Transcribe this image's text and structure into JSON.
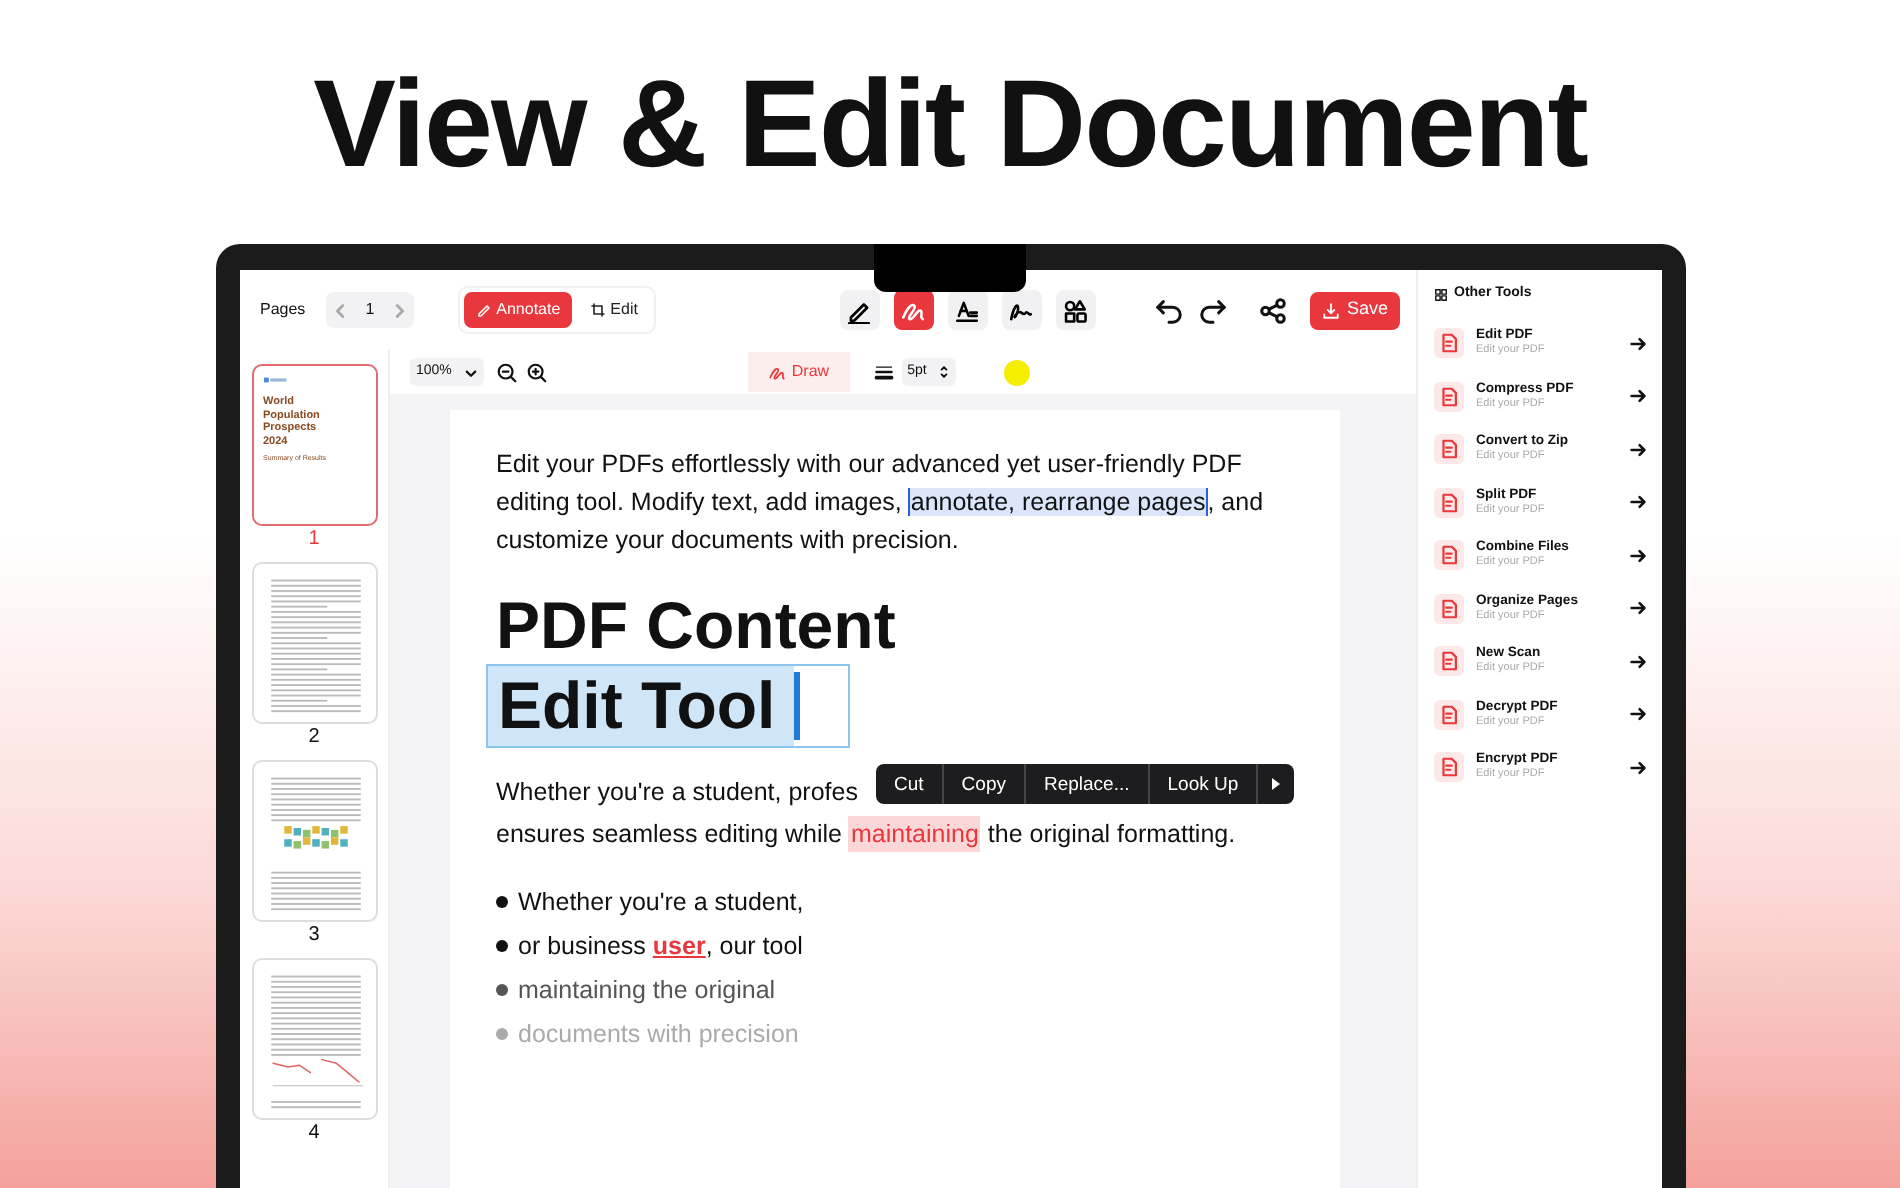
{
  "headline": "View & Edit Document",
  "toolbar": {
    "pages_label": "Pages",
    "page_number": "1",
    "modes": [
      {
        "kind": "annotate",
        "label": "Annotate",
        "selected": true
      },
      {
        "kind": "edit",
        "label": "Edit",
        "selected": false
      }
    ],
    "tools": [
      {
        "kind": "pen",
        "selected": false
      },
      {
        "kind": "draw",
        "selected": true
      },
      {
        "kind": "text",
        "selected": false
      },
      {
        "kind": "signature",
        "selected": false
      },
      {
        "kind": "shapes",
        "selected": false
      }
    ],
    "save": "Save"
  },
  "subtoolbar": {
    "zoom": "100%",
    "draw": "Draw",
    "stroke": "5pt",
    "color": "#f5ee00"
  },
  "thumbnails": [
    {
      "kind": "cover",
      "number": "1",
      "selected": true,
      "title": "World Population Prospects 2024",
      "subtitle": "Summary of Results"
    },
    {
      "kind": "text",
      "number": "2",
      "selected": false
    },
    {
      "kind": "grid-chart",
      "number": "3",
      "selected": false
    },
    {
      "kind": "line-chart",
      "number": "4",
      "selected": false
    }
  ],
  "document": {
    "intro": [
      {
        "text": "Edit your PDFs effortlessly with our advanced yet user-friendly PDF editing tool. Modify text, add images, ",
        "marked": false
      },
      {
        "text": "annotate, rearrange pages",
        "marked": true
      },
      {
        "text": ", and customize your documents with precision.",
        "marked": false
      }
    ],
    "heading": "PDF Content",
    "selected_heading": "Edit Tool",
    "paragraph_first_line": "Whether you're a student, profes",
    "paragraph_rest": [
      {
        "text": "ensures seamless editing while ",
        "marked": false
      },
      {
        "text": "maintaining",
        "marked": true
      },
      {
        "text": " the original formatting.",
        "marked": false
      }
    ],
    "bullets": [
      {
        "kind": "normal",
        "parts": [
          {
            "text": "Whether you're a student,",
            "marked": false
          }
        ]
      },
      {
        "kind": "normal",
        "parts": [
          {
            "text": "or business ",
            "marked": false
          },
          {
            "text": "user",
            "marked": true
          },
          {
            "text": ", our tool",
            "marked": false
          }
        ]
      },
      {
        "kind": "dim",
        "parts": [
          {
            "text": "maintaining the original",
            "marked": false
          }
        ]
      },
      {
        "kind": "faint",
        "parts": [
          {
            "text": "documents with precision",
            "marked": false
          }
        ]
      }
    ],
    "context_menu": [
      "Cut",
      "Copy",
      "Replace...",
      "Look Up"
    ]
  },
  "other_tools": {
    "title": "Other Tools",
    "items": [
      {
        "title": "Edit PDF",
        "subtitle": "Edit your PDF"
      },
      {
        "title": "Compress PDF",
        "subtitle": "Edit your PDF"
      },
      {
        "title": "Convert to Zip",
        "subtitle": "Edit your PDF"
      },
      {
        "title": "Split PDF",
        "subtitle": "Edit your PDF"
      },
      {
        "title": "Combine Files",
        "subtitle": "Edit your PDF"
      },
      {
        "title": "Organize Pages",
        "subtitle": "Edit your PDF"
      },
      {
        "title": "New Scan",
        "subtitle": "Edit your PDF"
      },
      {
        "title": "Decrypt PDF",
        "subtitle": "Edit your PDF"
      },
      {
        "title": "Encrypt PDF",
        "subtitle": "Edit your PDF"
      }
    ]
  }
}
